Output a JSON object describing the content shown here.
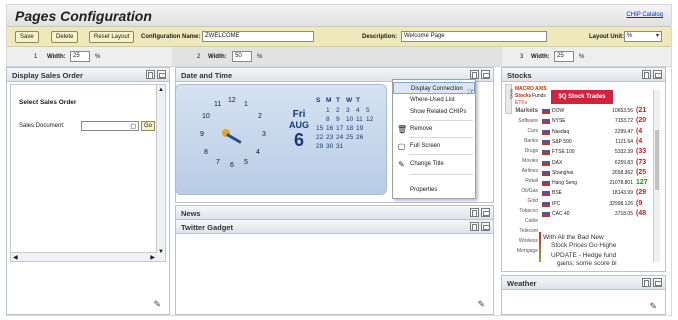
{
  "header": {
    "title": "Pages Configuration",
    "chip_link": "CHIP Catalog"
  },
  "toolbar": {
    "save": "Save",
    "delete": "Delete",
    "reset_layout": "Reset Layout",
    "config_name_label": "Configuration Name:",
    "config_name_value": "ZWELCOME",
    "description_label": "Description:",
    "description_value": "Welcome Page",
    "layout_unit_label": "Layout Unit:",
    "layout_unit_value": "%"
  },
  "columns": [
    {
      "number": "1",
      "width_label": "Width:",
      "width_value": "25",
      "unit": "%"
    },
    {
      "number": "2",
      "width_label": "Width:",
      "width_value": "50",
      "unit": "%"
    },
    {
      "number": "3",
      "width_label": "Width:",
      "width_value": "25",
      "unit": "%"
    }
  ],
  "panels": {
    "sales": {
      "title": "Display Sales Order",
      "heading": "Select Sales Order",
      "doc_label": "Sales Document:",
      "go": "Go"
    },
    "datetime": {
      "title": "Date and Time"
    },
    "news": {
      "title": "News"
    },
    "twitter": {
      "title": "Twitter Gadget"
    },
    "stocks": {
      "title": "Stocks"
    },
    "weather": {
      "title": "Weather"
    }
  },
  "clock": {
    "numbers": [
      "12",
      "1",
      "2",
      "3",
      "4",
      "5",
      "6",
      "7",
      "8",
      "9",
      "10",
      "11"
    ],
    "day": "Fri",
    "month": "AUG",
    "date": "6"
  },
  "calendar": {
    "headers": [
      "S",
      "M",
      "T",
      "W",
      "T"
    ],
    "rows": [
      [
        "",
        "1",
        "2",
        "3",
        "4",
        "5"
      ],
      [
        "",
        "8",
        "9",
        "10",
        "11",
        "12"
      ],
      [
        "15",
        "16",
        "17",
        "18",
        "19"
      ],
      [
        "22",
        "23",
        "24",
        "25",
        "26"
      ],
      [
        "29",
        "30",
        "31",
        "",
        ""
      ]
    ]
  },
  "context_menu": {
    "items": [
      "Display Connection",
      "Where-Used List",
      "Show Related CHIPs",
      "Remove",
      "Full Screen",
      "Change Title",
      "Properties"
    ]
  },
  "stocks_widget": {
    "brand_a": "MACRO AXIS",
    "tab_stocks": "Stocks",
    "tab_funds": "Funds",
    "tab_etfs": "ETFs",
    "free": "$Q Stock Trades",
    "close_tab": "Close",
    "sectors": [
      "Markets",
      "Software",
      "Cars",
      "Banks",
      "Drugs",
      "Movies",
      "Airlines",
      "Retail",
      "Oil/Gas",
      "Gold",
      "Tobacco",
      "Cable",
      "Telecom",
      "Wireless",
      "Mortgage"
    ],
    "rows": [
      {
        "name": "DOW",
        "value": "10653.56",
        "chg": "(21"
      },
      {
        "name": "NYSE",
        "value": "7153.72",
        "chg": "(20"
      },
      {
        "name": "Nasdaq",
        "value": "2299.47",
        "chg": "(4"
      },
      {
        "name": "S&P 500",
        "value": "1121.64",
        "chg": "(4"
      },
      {
        "name": "FTSE 100",
        "value": "5332.39",
        "chg": "(33"
      },
      {
        "name": "DAX",
        "value": "6259.83",
        "chg": "(73"
      },
      {
        "name": "Shanghai",
        "value": "2658.362",
        "chg": "(25"
      },
      {
        "name": "Hang Seng",
        "value": "21078.801",
        "chg": "127"
      },
      {
        "name": "BSE",
        "value": "18143.99",
        "chg": "(29"
      },
      {
        "name": "IPC",
        "value": "32998.126",
        "chg": "(9"
      },
      {
        "name": "CAC 40",
        "value": "3718.05",
        "chg": "(48"
      }
    ],
    "news": [
      "With All the Bad New",
      "Stock Prices Go Highe",
      "UPDATE - Hedge fund",
      "gains; some score bi"
    ]
  }
}
